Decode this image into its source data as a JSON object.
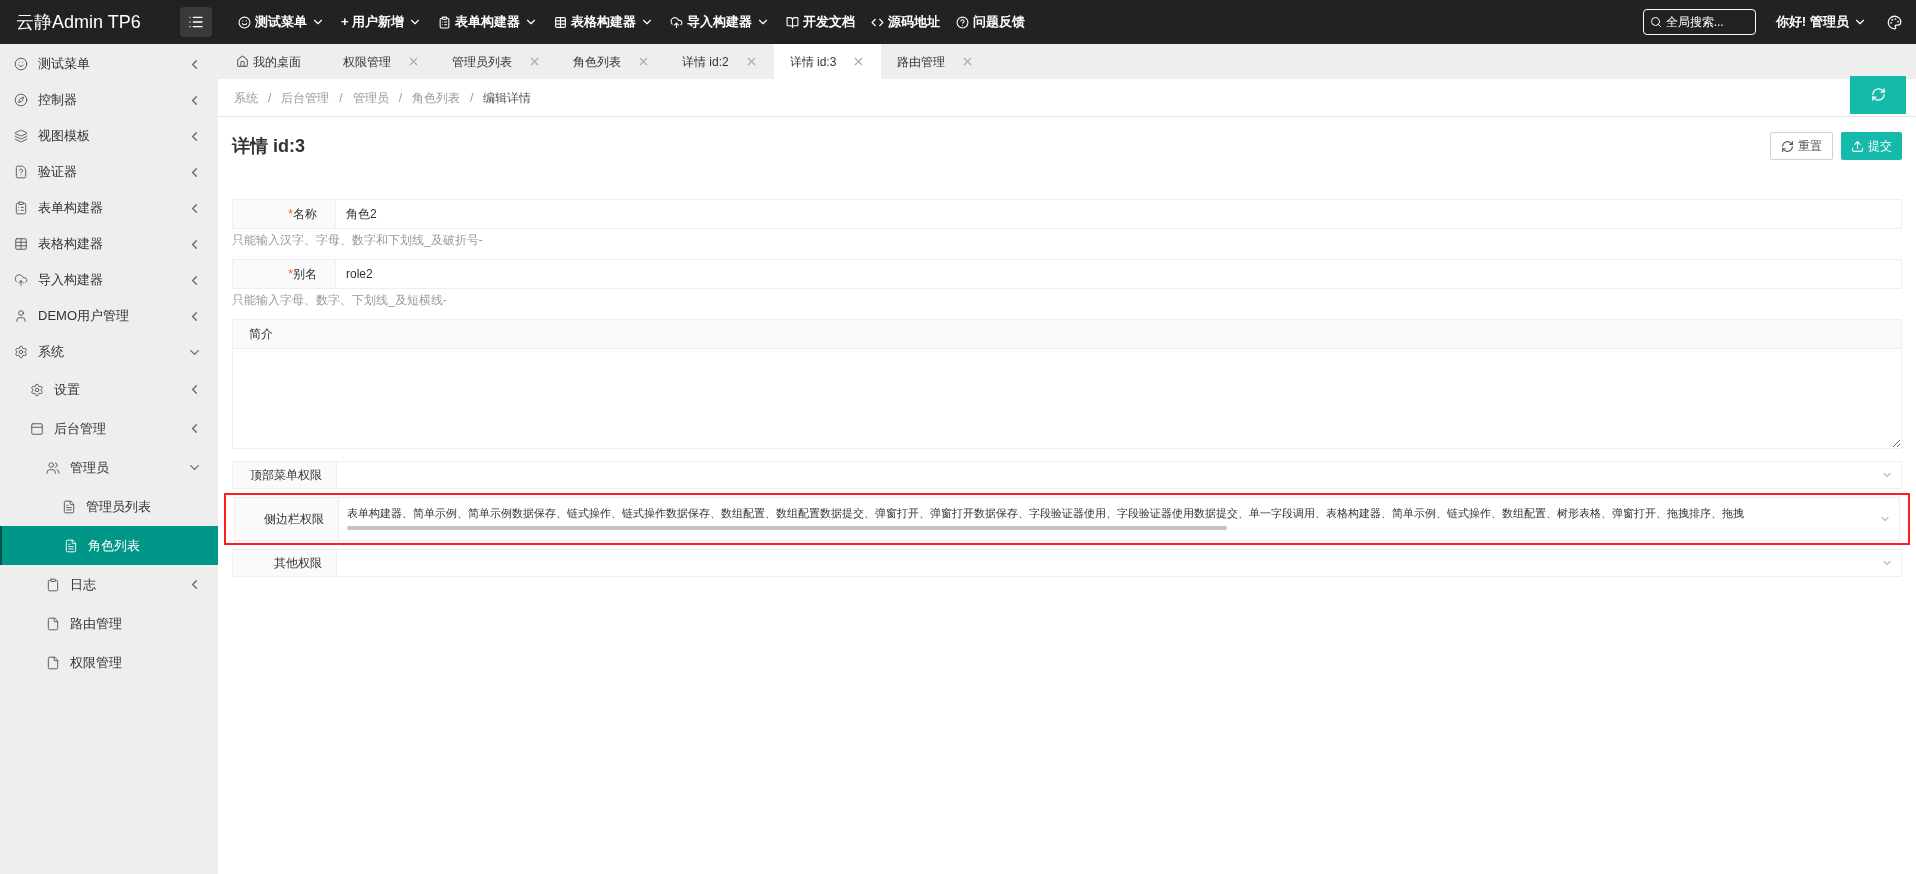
{
  "header": {
    "logo": "云静Admin TP6",
    "nav": [
      {
        "label": "测试菜单",
        "dropdown": true
      },
      {
        "label": "+ 用户新增",
        "dropdown": true
      },
      {
        "label": "表单构建器",
        "dropdown": true
      },
      {
        "label": "表格构建器",
        "dropdown": true
      },
      {
        "label": "导入构建器",
        "dropdown": true
      },
      {
        "label": "开发文档",
        "dropdown": false
      },
      {
        "label": "源码地址",
        "dropdown": false
      },
      {
        "label": "问题反馈",
        "dropdown": false
      }
    ],
    "search": {
      "placeholder": "全局搜索..."
    },
    "greeting": "你好!",
    "user": "管理员"
  },
  "sidebar": {
    "items": [
      {
        "label": "测试菜单",
        "expanded": false,
        "selected": false
      },
      {
        "label": "控制器",
        "expanded": false,
        "selected": false
      },
      {
        "label": "视图模板",
        "expanded": false,
        "selected": false
      },
      {
        "label": "验证器",
        "expanded": false,
        "selected": false
      },
      {
        "label": "表单构建器",
        "expanded": false,
        "selected": false
      },
      {
        "label": "表格构建器",
        "expanded": false,
        "selected": false
      },
      {
        "label": "导入构建器",
        "expanded": false,
        "selected": false
      },
      {
        "label": "DEMO用户管理",
        "expanded": false,
        "selected": false
      },
      {
        "label": "系统",
        "expanded": true,
        "selected": false,
        "children": [
          {
            "label": "设置",
            "expanded": false,
            "selected": false
          },
          {
            "label": "后台管理",
            "expanded": false,
            "selected": false,
            "children": [
              {
                "label": "管理员",
                "expanded": true,
                "selected": false,
                "children": [
                  {
                    "label": "管理员列表",
                    "selected": false
                  },
                  {
                    "label": "角色列表",
                    "selected": true
                  }
                ]
              },
              {
                "label": "日志",
                "expanded": false,
                "selected": false
              },
              {
                "label": "路由管理",
                "selected": false
              },
              {
                "label": "权限管理",
                "selected": false
              }
            ]
          }
        ]
      }
    ]
  },
  "tabs": [
    {
      "label": "我的桌面",
      "selected": false,
      "closable": false
    },
    {
      "label": "权限管理",
      "selected": false,
      "closable": true
    },
    {
      "label": "管理员列表",
      "selected": false,
      "closable": true
    },
    {
      "label": "角色列表",
      "selected": false,
      "closable": true
    },
    {
      "label": "详情 id:2",
      "selected": false,
      "closable": true
    },
    {
      "label": "详情 id:3",
      "selected": true,
      "closable": true
    },
    {
      "label": "路由管理",
      "selected": false,
      "closable": true
    }
  ],
  "breadcrumb": {
    "separator": "/",
    "items": [
      "系统",
      "后台管理",
      "管理员",
      "角色列表",
      "编辑详情"
    ]
  },
  "page": {
    "title": "详情 id:3",
    "buttons": [
      {
        "label": "重置",
        "kind": "reset"
      },
      {
        "label": "提交",
        "kind": "submit"
      }
    ]
  },
  "form": {
    "required_mark": "*",
    "fields": [
      {
        "kind": "text",
        "label": "名称",
        "required": true,
        "value": "角色2",
        "hint": "只能输入汉字、字母、数字和下划线_及破折号-"
      },
      {
        "kind": "text",
        "label": "别名",
        "required": true,
        "value": "role2",
        "hint": "只能输入字母、数字、下划线_及短横线-"
      },
      {
        "kind": "textarea",
        "label": "简介",
        "required": false
      },
      {
        "kind": "select",
        "label": "顶部菜单权限",
        "required": false,
        "highlighted": false
      },
      {
        "kind": "select",
        "label": "侧边栏权限",
        "required": false,
        "highlighted": true,
        "value": "表单构建器、简单示例、简单示例数据保存、链式操作、链式操作数据保存、数组配置、数组配置数据提交、弹窗打开、弹窗打开数据保存、字段验证器使用、字段验证器使用数据提交、单一字段调用、表格构建器、简单示例、链式操作、数组配置、树形表格、弹窗打开、拖拽排序、拖拽"
      },
      {
        "kind": "select",
        "label": "其他权限",
        "required": false,
        "highlighted": false
      }
    ]
  }
}
